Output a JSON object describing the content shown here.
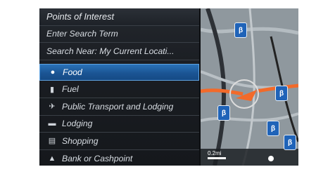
{
  "menu": {
    "title": "Points of Interest",
    "items": [
      {
        "label": "Enter Search Term",
        "icon": ""
      },
      {
        "label": "Search Near: My Current Locati...",
        "icon": ""
      },
      {
        "label": "Food",
        "icon": "food-icon",
        "glyph": "🍽",
        "selected": true
      },
      {
        "label": "Fuel",
        "icon": "fuel-icon",
        "glyph": "⛽"
      },
      {
        "label": "Public Transport and Lodging",
        "icon": "airplane-icon",
        "glyph": "✈"
      },
      {
        "label": "Lodging",
        "icon": "bed-icon",
        "glyph": "🛏"
      },
      {
        "label": "Shopping",
        "icon": "cart-icon",
        "glyph": "🛒"
      },
      {
        "label": "Bank or Cashpoint",
        "icon": "bank-icon",
        "glyph": "🏦"
      }
    ]
  },
  "map": {
    "scale_label": "0.2mi",
    "colors": {
      "route": "#f26a2a",
      "poi": "#1f63b8",
      "selection": "#1b5594"
    }
  }
}
